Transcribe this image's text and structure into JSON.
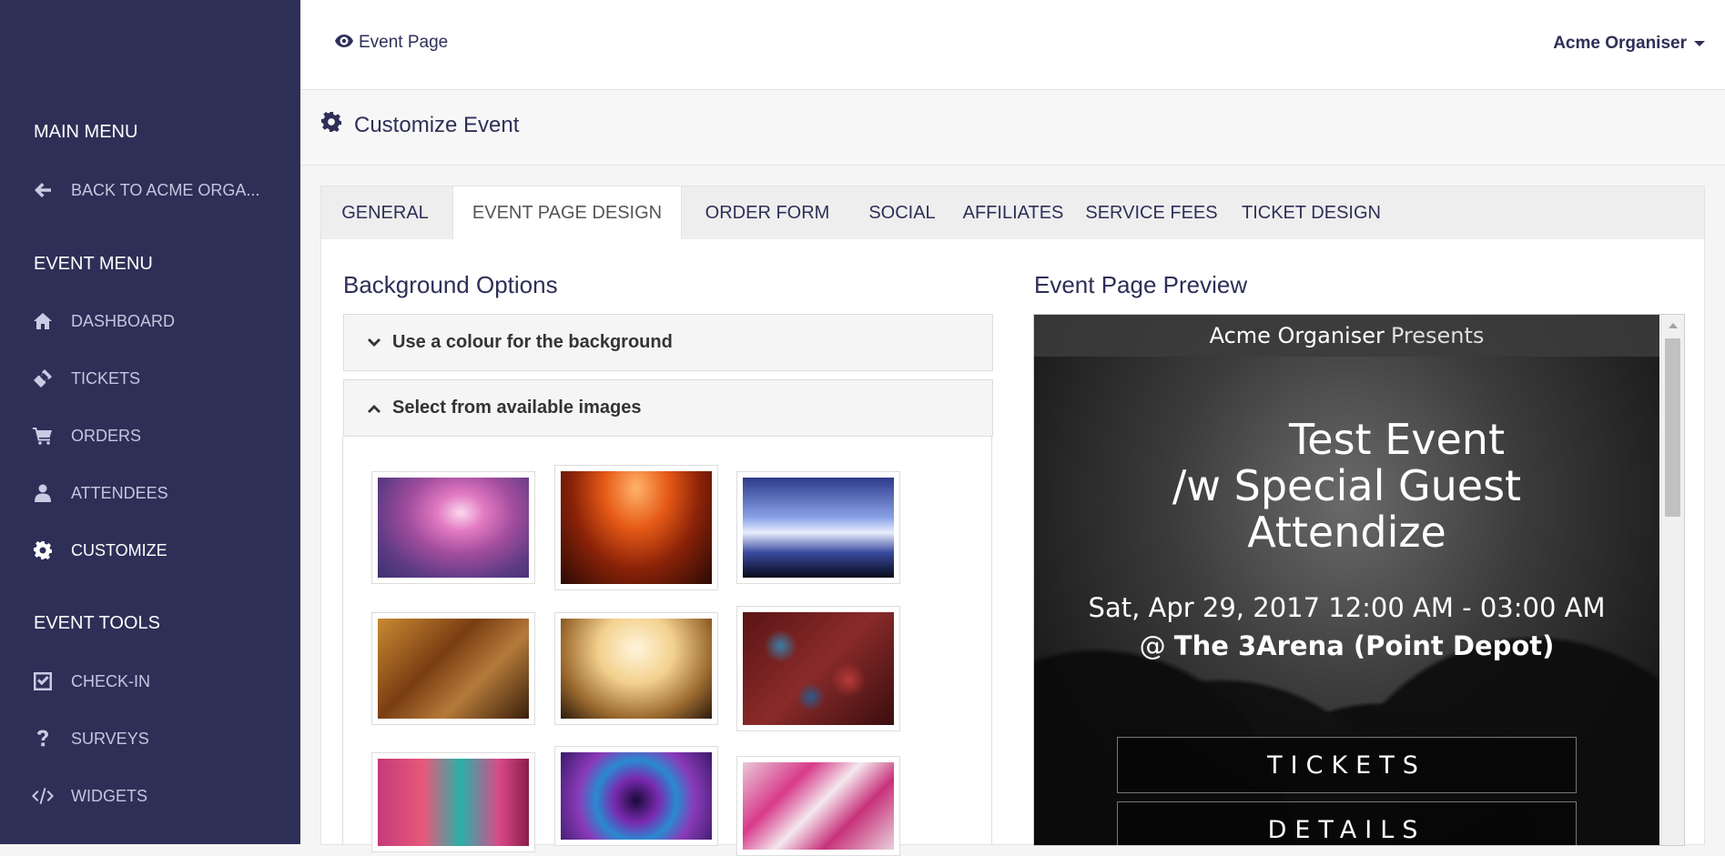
{
  "sidebar": {
    "main_heading": "MAIN MENU",
    "back_item": {
      "label": "BACK TO ACME ORGA...",
      "icon": "arrow-left-icon"
    },
    "event_heading": "EVENT MENU",
    "event_items": [
      {
        "label": "DASHBOARD",
        "icon": "home-icon"
      },
      {
        "label": "TICKETS",
        "icon": "ticket-icon"
      },
      {
        "label": "ORDERS",
        "icon": "cart-icon"
      },
      {
        "label": "ATTENDEES",
        "icon": "user-icon"
      },
      {
        "label": "CUSTOMIZE",
        "icon": "gear-icon"
      }
    ],
    "tools_heading": "EVENT TOOLS",
    "tool_items": [
      {
        "label": "CHECK-IN",
        "icon": "checkbox-icon"
      },
      {
        "label": "SURVEYS",
        "icon": "question-icon"
      },
      {
        "label": "WIDGETS",
        "icon": "code-icon"
      }
    ],
    "bg_color": "#2e2f57"
  },
  "topbar": {
    "event_page_link": "Event Page",
    "organiser_menu": "Acme Organiser"
  },
  "page_header": {
    "title": "Customize Event"
  },
  "tabs": [
    {
      "label": "GENERAL"
    },
    {
      "label": "EVENT PAGE DESIGN"
    },
    {
      "label": "ORDER FORM"
    },
    {
      "label": "SOCIAL"
    },
    {
      "label": "AFFILIATES"
    },
    {
      "label": "SERVICE FEES"
    },
    {
      "label": "TICKET DESIGN"
    }
  ],
  "active_tab": "EVENT PAGE DESIGN",
  "background_options": {
    "title": "Background Options",
    "colour_panel": "Use a colour for the background",
    "images_panel": "Select from available images"
  },
  "preview": {
    "title": "Event Page Preview",
    "organiser": "Acme Organiser",
    "presents": "Presents",
    "event_title_lines": [
      "Test Event",
      "/w Special Guest",
      "Attendize"
    ],
    "date": "Sat, Apr 29, 2017 12:00 AM - 03:00 AM",
    "venue_prefix": "@",
    "venue": "The 3Arena (Point Depot)",
    "tickets_button": "TICKETS",
    "details_button": "DETAILS"
  }
}
